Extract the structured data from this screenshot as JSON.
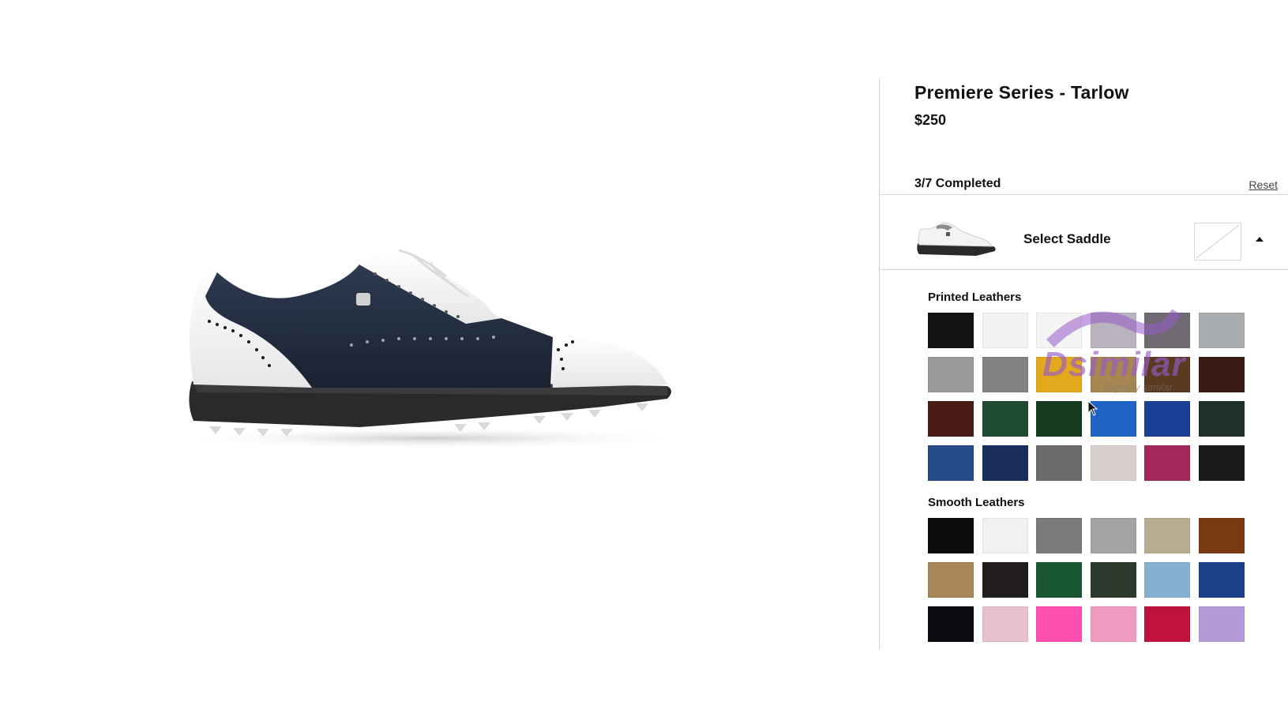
{
  "product": {
    "title": "Premiere Series - Tarlow",
    "price": "$250"
  },
  "progress": {
    "label": "3/7 Completed",
    "reset_label": "Reset"
  },
  "step": {
    "label": "Select Saddle",
    "thumbnail_icon": "shoe-thumbnail",
    "expand_icon": "chevron-up-icon"
  },
  "sections": [
    {
      "title": "Printed Leathers",
      "swatches": [
        "#121212",
        "#f2f2f2",
        "#f4f4f4",
        "#b9b3bd",
        "#6f6a72",
        "#a9acaf",
        "#9a9a9a",
        "#828282",
        "#e3a91c",
        "#a8864f",
        "#5b3a1f",
        "#3a1a12",
        "#4a1c16",
        "#1f4a33",
        "#173a1f",
        "#1f63c6",
        "#1a3f95",
        "#1e2f2c",
        "#264a86",
        "#1a2e5c",
        "#6b6b6b",
        "#d6cfcc",
        "#a3285a",
        "#1a1a1d"
      ]
    },
    {
      "title": "Smooth Leathers",
      "swatches": [
        "#0c0c0c",
        "#f1f1f1",
        "#7b7b7b",
        "#a3a3a3",
        "#b6ad92",
        "#7a3b12",
        "#a8865a",
        "#221d1d",
        "#185634",
        "#2c3a2d",
        "#86b0d1",
        "#1c3f8a",
        "#0b0c12",
        "#e9c1cd",
        "#ff4fb0",
        "#f09cc0",
        "#c0123e",
        "#b49ad8"
      ]
    }
  ],
  "watermark": {
    "brand": "Dsimilar",
    "tagline": "Digitally similar"
  }
}
